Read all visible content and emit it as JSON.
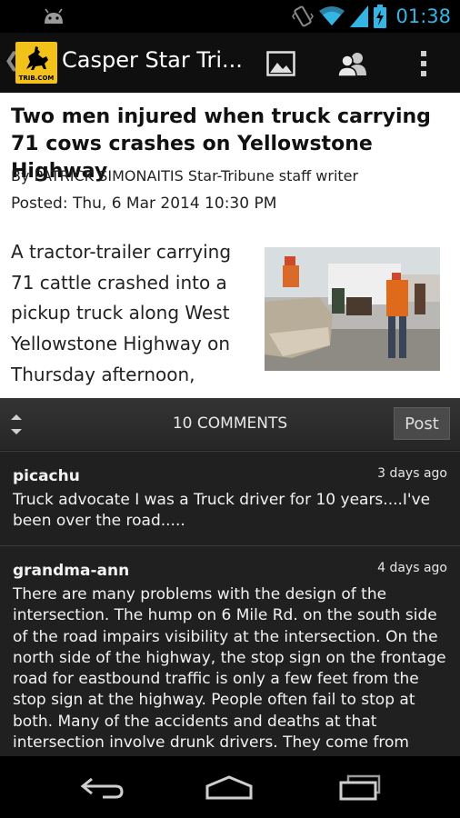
{
  "status_bar": {
    "time": "01:38",
    "icons": [
      "android-icon",
      "vibrate-icon",
      "wifi-icon",
      "signal-icon",
      "battery-charging-icon"
    ],
    "accent_color": "#33b5e5"
  },
  "action_bar": {
    "title": "Casper Star Tri...",
    "logo_text": "TRIB.COM",
    "icons": [
      "up-caret-icon",
      "image-icon",
      "people-icon",
      "overflow-menu-icon"
    ]
  },
  "article": {
    "headline": "Two men injured when truck carrying 71 cows crashes on Yellowstone Highway",
    "byline": "By PATRICK SIMONAITIS Star-Tribune staff writer",
    "posted": "Posted: Thu, 6 Mar 2014 10:30 PM",
    "body_lines": [
      "A tractor-trailer carrying",
      "71 cattle crashed into a",
      "pickup truck along West",
      "Yellowstone Highway on",
      "Thursday afternoon,"
    ]
  },
  "comments": {
    "count_label": "10 COMMENTS",
    "post_label": "Post",
    "items": [
      {
        "user": "picachu",
        "time": "3 days ago",
        "text": "Truck advocate I was a Truck driver for 10 years....I've been over the road....."
      },
      {
        "user": "grandma-ann",
        "time": "4 days ago",
        "text": "There are many problems with the design of the intersection. The hump on 6 Mile Rd. on the south side of the road impairs visibility at the intersection. On the north side of the highway, the stop sign on the frontage road for eastbound traffic is only a few feet from the stop sign at the highway. People often fail to stop at both. Many of the accidents and deaths at that intersection involve drunk drivers. They come from"
      }
    ]
  },
  "nav_bar": {
    "icons": [
      "back-icon",
      "home-icon",
      "recent-apps-icon"
    ]
  }
}
